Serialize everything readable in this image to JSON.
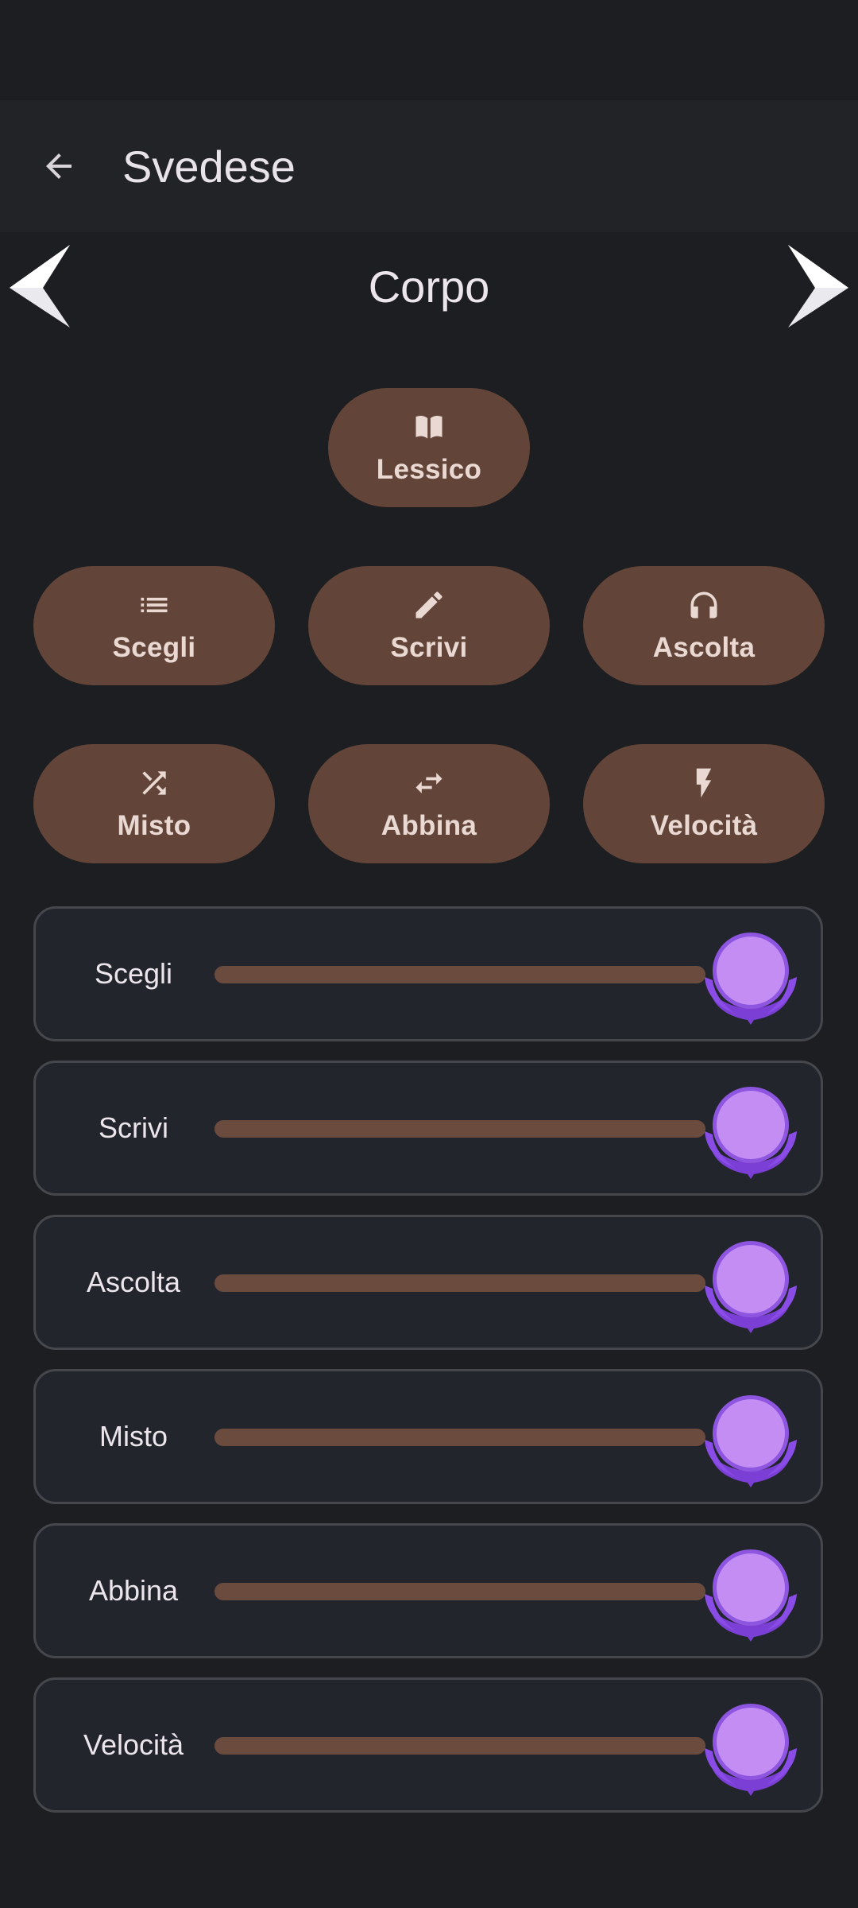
{
  "app_bar": {
    "title": "Svedese",
    "back_icon": "arrow-back-icon"
  },
  "topic": {
    "title": "Corpo",
    "prev_icon": "chevron-left-icon",
    "next_icon": "chevron-right-icon"
  },
  "modes": {
    "lessico": {
      "label": "Lessico",
      "icon": "book-icon"
    },
    "scegli": {
      "label": "Scegli",
      "icon": "list-icon"
    },
    "scrivi": {
      "label": "Scrivi",
      "icon": "pencil-icon"
    },
    "ascolta": {
      "label": "Ascolta",
      "icon": "headphones-icon"
    },
    "misto": {
      "label": "Misto",
      "icon": "shuffle-icon"
    },
    "abbina": {
      "label": "Abbina",
      "icon": "swap-icon"
    },
    "velocita": {
      "label": "Velocità",
      "icon": "bolt-icon"
    }
  },
  "progress": [
    {
      "label": "Scegli",
      "progress": 1.0,
      "badge_icon": "laurel-medal-icon"
    },
    {
      "label": "Scrivi",
      "progress": 1.0,
      "badge_icon": "laurel-medal-icon"
    },
    {
      "label": "Ascolta",
      "progress": 1.0,
      "badge_icon": "laurel-medal-icon"
    },
    {
      "label": "Misto",
      "progress": 1.0,
      "badge_icon": "laurel-medal-icon"
    },
    {
      "label": "Abbina",
      "progress": 1.0,
      "badge_icon": "laurel-medal-icon"
    },
    {
      "label": "Velocità",
      "progress": 1.0,
      "badge_icon": "laurel-medal-icon"
    }
  ],
  "colors": {
    "background": "#1d1e21",
    "app_bar": "#222327",
    "button": "#624538",
    "card": "#23252d",
    "medal": "#c48df4"
  }
}
